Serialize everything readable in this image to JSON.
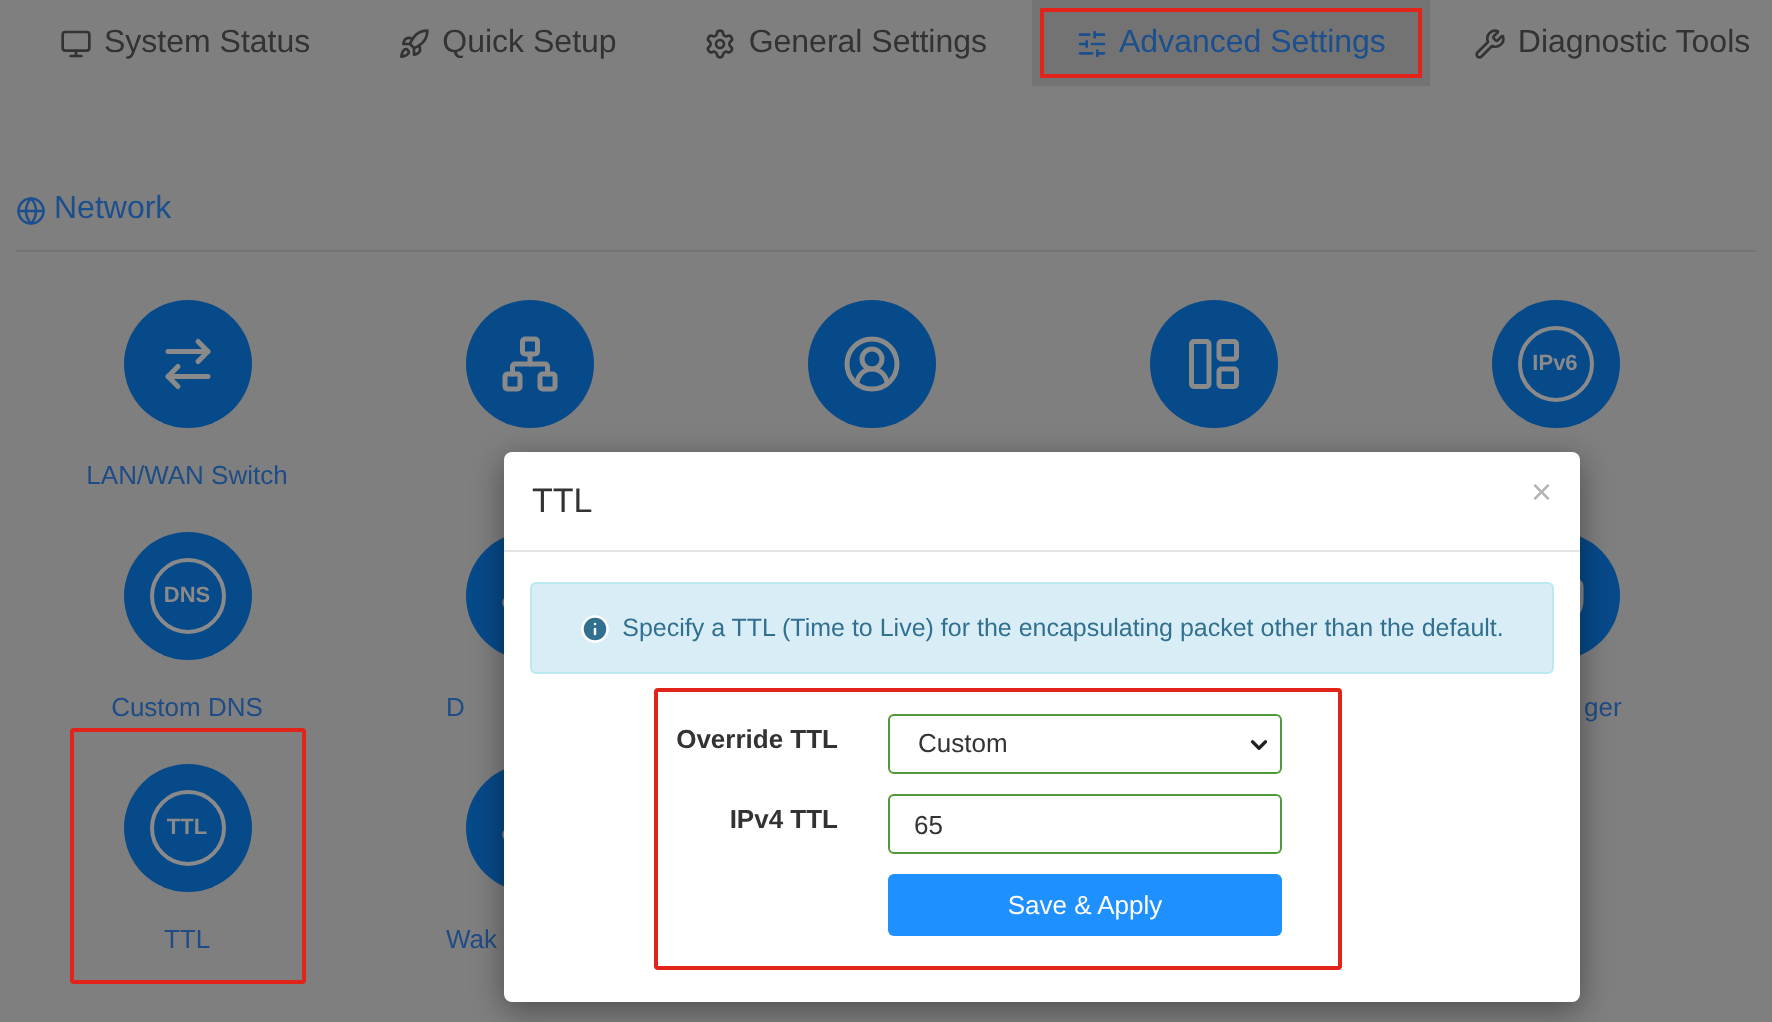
{
  "tabs": [
    {
      "label": "System Status",
      "selected": false,
      "highlighted": false
    },
    {
      "label": "Quick Setup",
      "selected": false,
      "highlighted": false
    },
    {
      "label": "General Settings",
      "selected": false,
      "highlighted": false
    },
    {
      "label": "Advanced Settings",
      "selected": true,
      "highlighted": true
    },
    {
      "label": "Diagnostic Tools",
      "selected": false,
      "highlighted": false
    }
  ],
  "section": {
    "title": "Network"
  },
  "rows": [
    [
      {
        "label": "LAN/WAN Switch",
        "highlighted": false
      },
      {
        "highlighted": false
      },
      {
        "highlighted": false
      },
      {
        "highlighted": false
      },
      {
        "badge": "IPv6",
        "highlighted": false
      }
    ],
    [
      {
        "label": "Custom DNS",
        "badge": "DNS",
        "highlighted": false
      },
      {
        "label": "D",
        "highlighted": false
      },
      {
        "label": "ger",
        "highlighted": false
      }
    ],
    [
      {
        "label": "TTL",
        "badge": "TTL",
        "highlighted": true
      },
      {
        "label": "Wak",
        "highlighted": false
      }
    ]
  ],
  "dialog": {
    "title": "TTL",
    "close": "×",
    "info": "Specify a TTL (Time to Live) for the encapsulating packet other than the default.",
    "form": {
      "highlighted": true,
      "fields": [
        {
          "kind": "select",
          "label": "Override TTL",
          "value": "Custom"
        },
        {
          "kind": "input",
          "label": "IPv4 TTL",
          "value": "65"
        }
      ],
      "button": "Save & Apply"
    }
  }
}
